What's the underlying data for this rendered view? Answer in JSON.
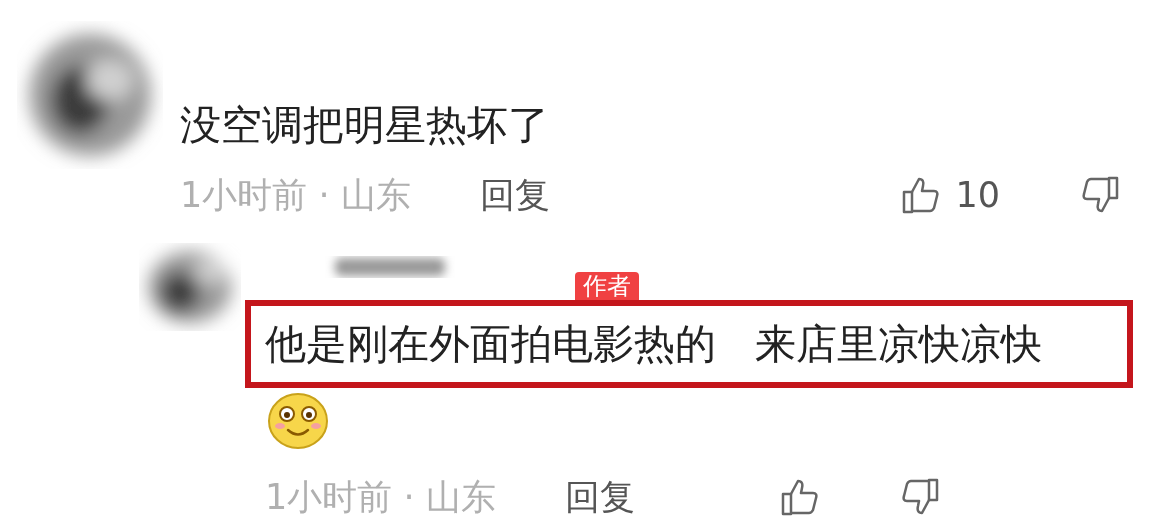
{
  "comments": [
    {
      "kind": "comment",
      "text": "没空调把明星热坏了",
      "time_location": "1小时前 · 山东",
      "reply": "回复",
      "likes": "10"
    },
    {
      "kind": "reply",
      "author_badge": "作者",
      "text": "他是刚在外面拍电影热的   来店里凉快凉快",
      "highlighted": true,
      "sticker": true,
      "time_location": "1小时前 · 山东",
      "reply": "回复"
    }
  ]
}
